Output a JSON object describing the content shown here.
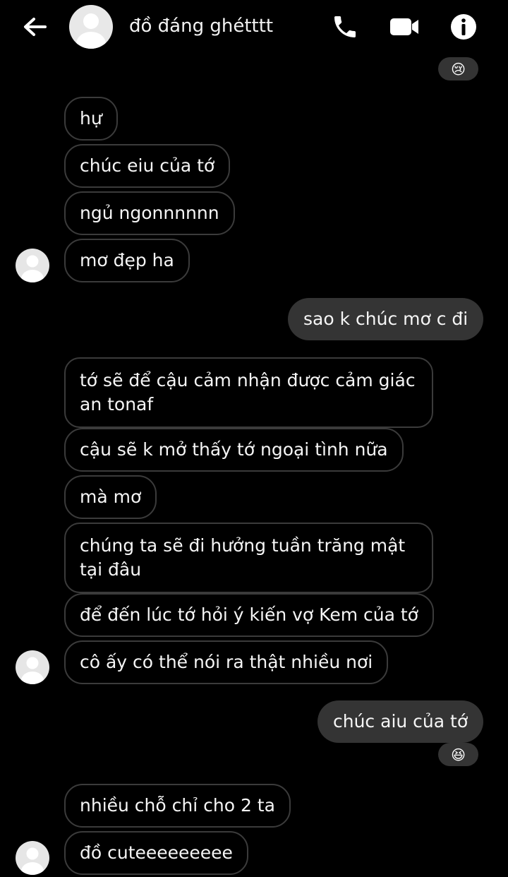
{
  "header": {
    "title": "đồ đáng ghétttt"
  },
  "reactions": {
    "top": "😢",
    "middle": "😆"
  },
  "messages": {
    "g1": [
      "hự",
      "chúc eiu của tớ",
      "ngủ ngonnnnnn",
      "mơ đẹp ha"
    ],
    "s1": "sao k chúc mơ c đi",
    "g2": [
      "tớ sẽ để cậu cảm nhận được cảm giác an tonaf",
      "cậu sẽ k mở thấy tớ ngoại tình nữa",
      "mà mơ",
      "chúng ta sẽ đi hưởng tuần trăng mật tại đâu",
      "để đến lúc tớ hỏi ý kiến vợ Kem của tớ",
      "cô ấy có thể nói ra thật nhiều nơi"
    ],
    "s2": "chúc aiu của tớ",
    "g3": [
      "nhiều chỗ chỉ cho 2 ta",
      "đồ cuteeeeeeeee"
    ]
  },
  "colors": {
    "background": "#000000",
    "sent_bubble": "#343434",
    "received_border": "#3b3b3b",
    "avatar": "#e6e6e6"
  }
}
